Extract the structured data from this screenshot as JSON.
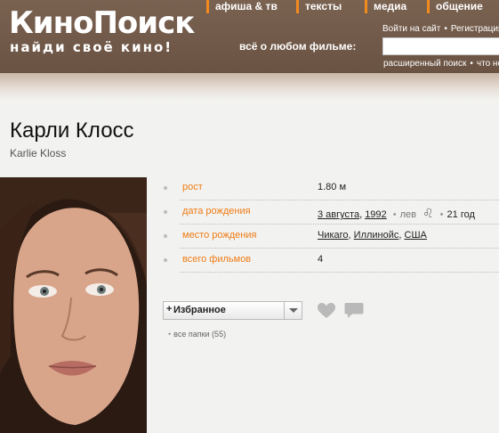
{
  "header": {
    "logo": "КиноПоиск",
    "tagline": "найди своё кино!",
    "nav": [
      {
        "label": "афиша & тв"
      },
      {
        "label": "тексты"
      },
      {
        "label": "медиа"
      },
      {
        "label": "общение"
      }
    ],
    "search_label": "всё о любом фильме:",
    "search_value": "",
    "login_link": "Войти на сайт",
    "register_link": "Регистрация",
    "advanced_search": "расширенный поиск",
    "what_new": "что нового"
  },
  "person": {
    "name_ru": "Карли Клосс",
    "name_en": "Karlie Kloss"
  },
  "info": {
    "height": {
      "label": "рост",
      "value": "1.80 м"
    },
    "birth": {
      "label": "дата рождения",
      "date": "3 августа",
      "year": "1992",
      "sign": "лев",
      "sign_glyph": "♌",
      "age": "21 год"
    },
    "place": {
      "label": "место рождения",
      "city": "Чикаго",
      "state": "Иллинойс",
      "country": "США"
    },
    "films": {
      "label": "всего фильмов",
      "value": "4"
    }
  },
  "favorites": {
    "plus": "+",
    "label": "Избранное",
    "folders": "все папки (55)"
  },
  "icons": {
    "heart": "heart-icon",
    "comment": "comment-icon",
    "dropdown": "chevron-down-icon"
  },
  "colors": {
    "header_bg": "#6a5343",
    "nav_accent": "#f28a1e",
    "label_orange": "#f07c16",
    "page_bg": "#f2f2f0"
  }
}
